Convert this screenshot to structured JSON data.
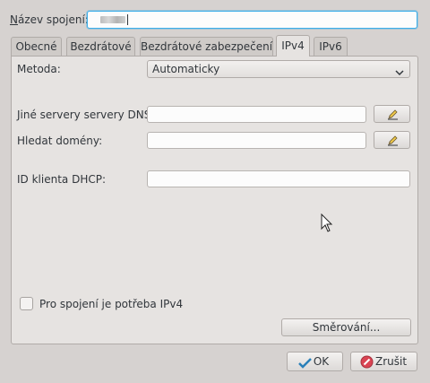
{
  "connection": {
    "name_label_pre": "N",
    "name_label_rest": "ázev spojení:",
    "name_value": ""
  },
  "tabs": [
    {
      "label": "Obecné"
    },
    {
      "label": "Bezdrátové"
    },
    {
      "label": "Bezdrátové zabezpečení"
    },
    {
      "label": "IPv4"
    },
    {
      "label": "IPv6"
    }
  ],
  "ipv4": {
    "method_label": "Metoda:",
    "method_value": "Automaticky",
    "dns_label": "Jiné servery servery DNS:",
    "dns_value": "",
    "search_domains_label": "Hledat domény:",
    "search_domains_value": "",
    "dhcp_client_id_label": "ID klienta DHCP:",
    "dhcp_client_id_value": "",
    "require_ipv4_label": "Pro spojení je potřeba IPv4",
    "require_ipv4_checked": false,
    "routes_button": "Směrování..."
  },
  "dialog": {
    "ok_label": "OK",
    "cancel_label": "Zrušit"
  },
  "colors": {
    "accent": "#3daee9",
    "cancel_icon": "#da4453",
    "ok_icon": "#2980b9"
  }
}
